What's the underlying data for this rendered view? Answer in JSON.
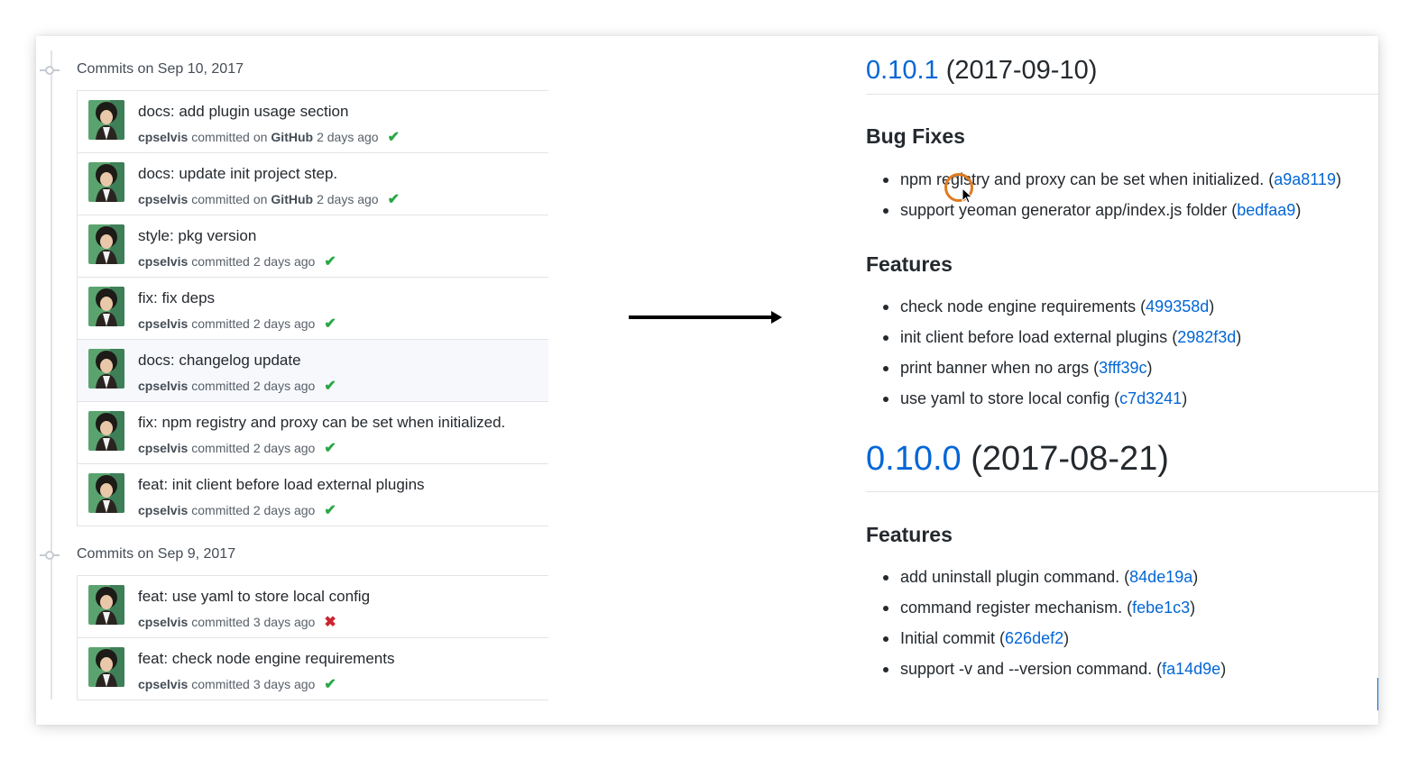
{
  "commit_history": {
    "groups": [
      {
        "title": "Commits on Sep 10, 2017",
        "commits": [
          {
            "message": "docs: add plugin usage section",
            "author": "cpselvis",
            "verb": "committed",
            "on_label": "on",
            "platform": "GitHub",
            "when": "2 days ago",
            "status": "success"
          },
          {
            "message": "docs: update init project step.",
            "author": "cpselvis",
            "verb": "committed",
            "on_label": "on",
            "platform": "GitHub",
            "when": "2 days ago",
            "status": "success"
          },
          {
            "message": "style: pkg version",
            "author": "cpselvis",
            "verb": "committed",
            "when": "2 days ago",
            "status": "success"
          },
          {
            "message": "fix: fix deps",
            "author": "cpselvis",
            "verb": "committed",
            "when": "2 days ago",
            "status": "success"
          },
          {
            "message": "docs: changelog update",
            "author": "cpselvis",
            "verb": "committed",
            "when": "2 days ago",
            "status": "success",
            "highlighted": true
          },
          {
            "message": "fix: npm registry and proxy can be set when initialized.",
            "author": "cpselvis",
            "verb": "committed",
            "when": "2 days ago",
            "status": "success"
          },
          {
            "message": "feat: init client before load external plugins",
            "author": "cpselvis",
            "verb": "committed",
            "when": "2 days ago",
            "status": "success"
          }
        ]
      },
      {
        "title": "Commits on Sep 9, 2017",
        "commits": [
          {
            "message": "feat: use yaml to store local config",
            "author": "cpselvis",
            "verb": "committed",
            "when": "3 days ago",
            "status": "failure"
          },
          {
            "message": "feat: check node engine requirements",
            "author": "cpselvis",
            "verb": "committed",
            "when": "3 days ago",
            "status": "success"
          }
        ]
      }
    ],
    "status_icons": {
      "success": "check-icon",
      "failure": "x-icon"
    },
    "colors": {
      "success": "#28a745",
      "failure": "#cb2431",
      "link": "#0366d6"
    }
  },
  "arrow": {
    "icon": "right-arrow-icon"
  },
  "changelog": {
    "versions": [
      {
        "number": "0.10.1",
        "date": "(2017-09-10)",
        "sections": [
          {
            "title": "Bug Fixes",
            "items": [
              {
                "text": "npm registry and proxy can be set when initialized.",
                "hash": "a9a8119"
              },
              {
                "text": "support yeoman generator app/index.js folder",
                "hash": "bedfaa9"
              }
            ]
          },
          {
            "title": "Features",
            "items": [
              {
                "text": "check node engine requirements",
                "hash": "499358d"
              },
              {
                "text": "init client before load external plugins",
                "hash": "2982f3d"
              },
              {
                "text": "print banner when no args",
                "hash": "3fff39c"
              },
              {
                "text": "use yaml to store local config",
                "hash": "c7d3241"
              }
            ]
          }
        ]
      },
      {
        "number": "0.10.0",
        "date": "(2017-08-21)",
        "sections": [
          {
            "title": "Features",
            "items": [
              {
                "text": "add uninstall plugin command.",
                "hash": "84de19a"
              },
              {
                "text": "command register mechanism.",
                "hash": "febe1c3"
              },
              {
                "text": "Initial commit",
                "hash": "626def2"
              },
              {
                "text": "support -v and --version command.",
                "hash": "fa14d9e"
              }
            ]
          }
        ]
      }
    ]
  }
}
